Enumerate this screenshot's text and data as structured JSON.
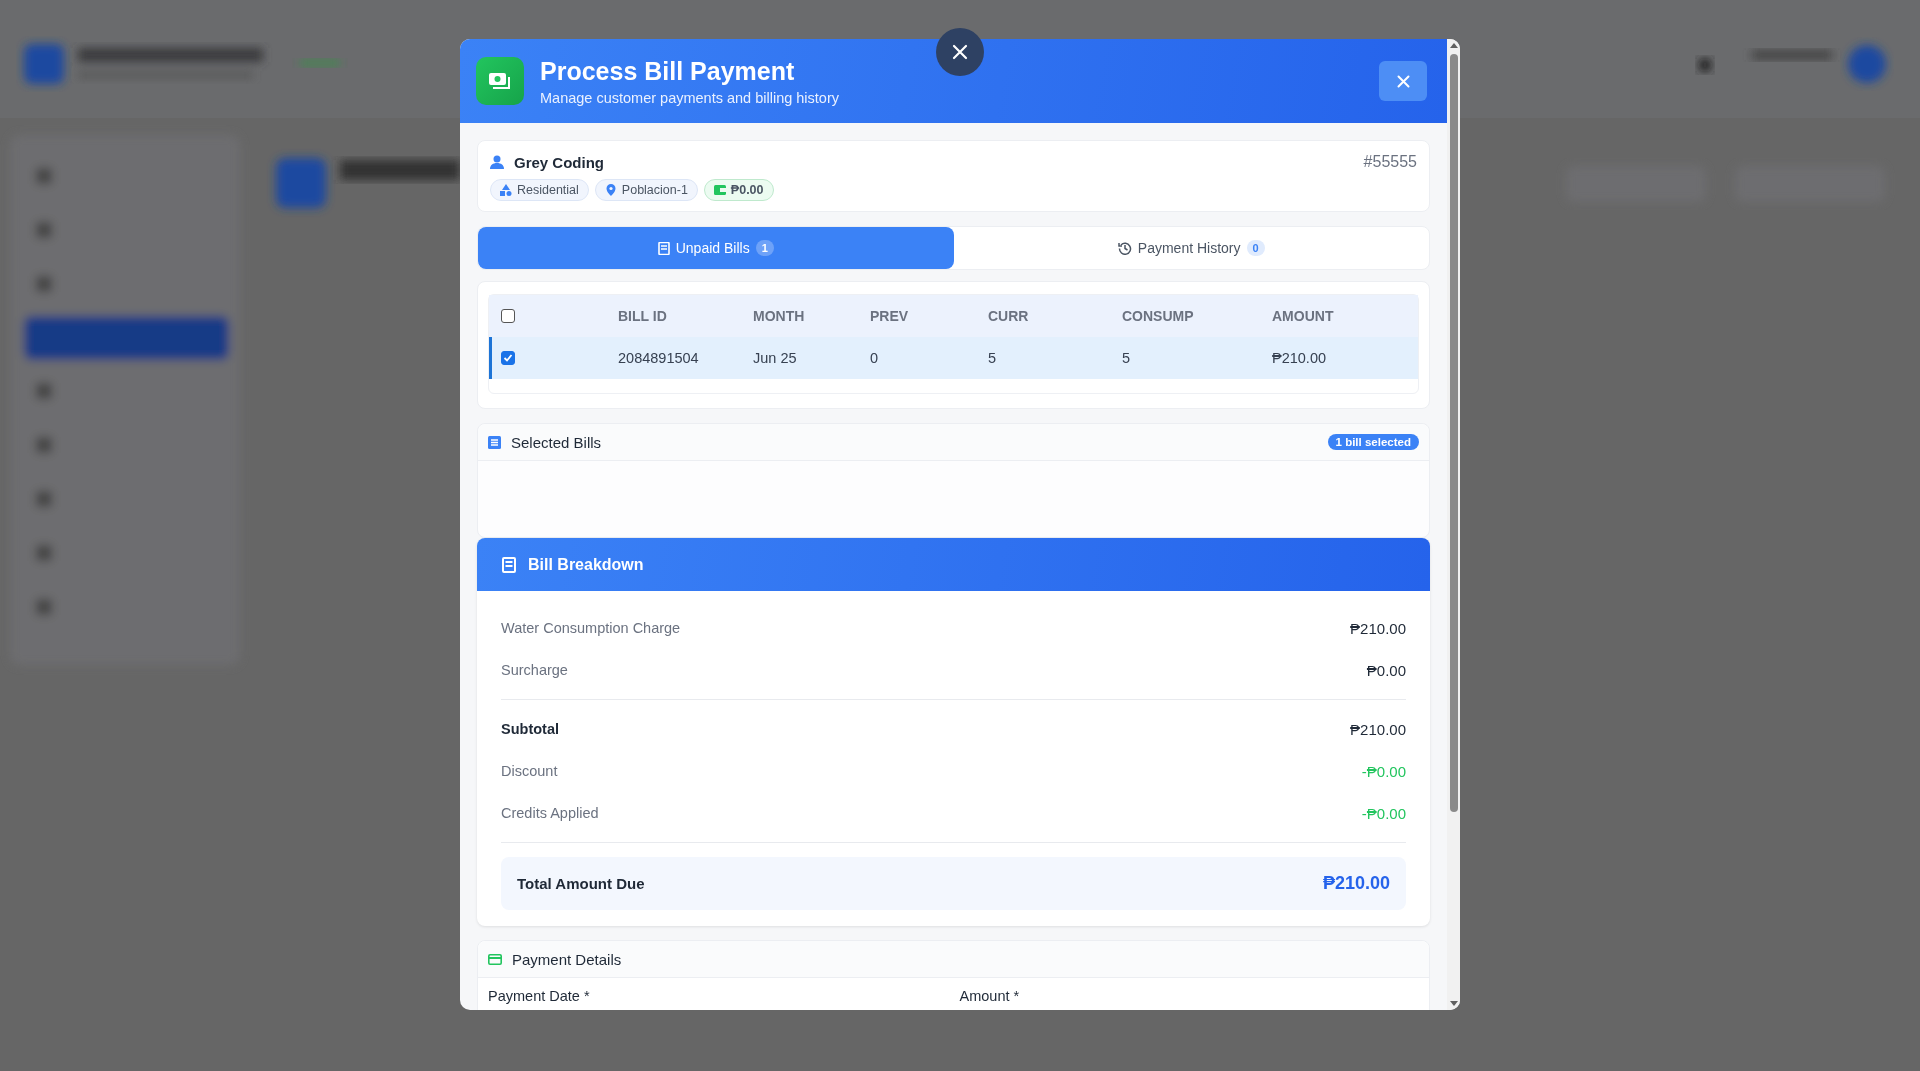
{
  "modal": {
    "title": "Process Bill Payment",
    "subtitle": "Manage customer payments and billing history"
  },
  "customer": {
    "name": "Grey Coding",
    "account_no": "#55555",
    "tags": [
      {
        "kind": "type",
        "label": "Residential"
      },
      {
        "kind": "location",
        "label": "Poblacion-1"
      },
      {
        "kind": "balance",
        "label": "₱0.00"
      }
    ]
  },
  "tabs": [
    {
      "label": "Unpaid Bills",
      "count": "1",
      "kind": "bills",
      "selected": true
    },
    {
      "label": "Payment History",
      "count": "0",
      "kind": "history",
      "selected": false
    }
  ],
  "bills_table": {
    "select_all": {
      "checked": false
    },
    "columns": [
      "BILL ID",
      "MONTH",
      "PREV",
      "CURR",
      "CONSUMP",
      "AMOUNT"
    ],
    "rows": [
      {
        "checked": true,
        "selected": true,
        "cells": [
          "2084891504",
          "Jun 25",
          "0",
          "5",
          "5",
          "₱210.00"
        ]
      }
    ]
  },
  "selected_bills": {
    "title": "Selected Bills",
    "badge": "1 bill selected"
  },
  "breakdown": {
    "title": "Bill Breakdown",
    "lines": [
      {
        "kind": "charge",
        "label": "Water Consumption Charge",
        "amount": "₱210.00"
      },
      {
        "kind": "charge",
        "label": "Surcharge",
        "amount": "₱0.00"
      },
      {
        "kind": "subtotal",
        "label": "Subtotal",
        "amount": "₱210.00"
      },
      {
        "kind": "deduction",
        "label": "Discount",
        "amount": "-₱0.00"
      },
      {
        "kind": "deduction",
        "label": "Credits Applied",
        "amount": "-₱0.00"
      }
    ],
    "total": {
      "label": "Total Amount Due",
      "amount": "₱210.00"
    }
  },
  "payment_details": {
    "title": "Payment Details",
    "fields": [
      {
        "label": "Payment Date *"
      },
      {
        "label": "Amount *"
      }
    ]
  }
}
